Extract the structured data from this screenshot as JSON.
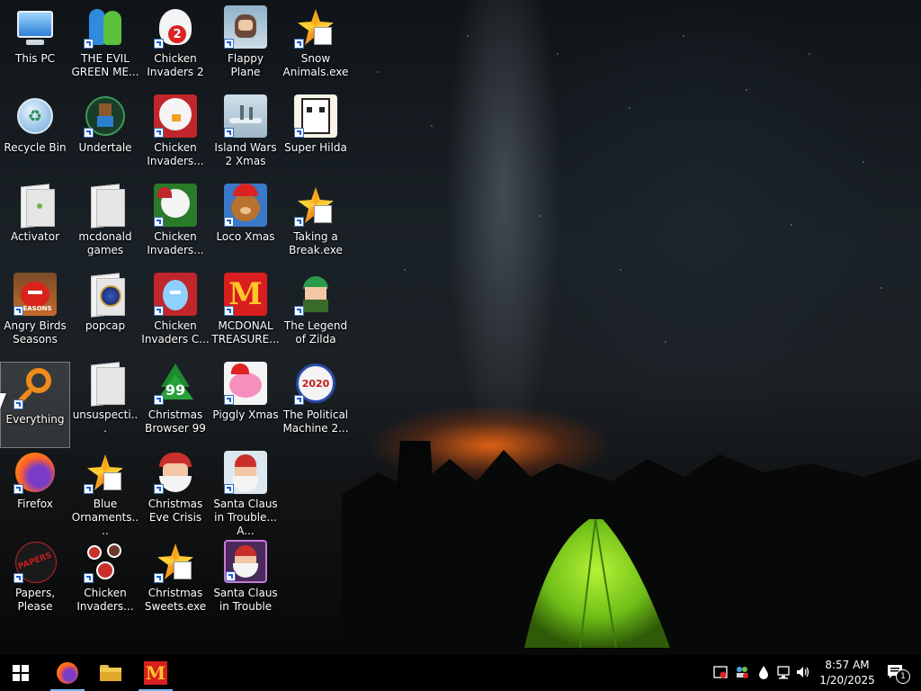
{
  "desktop": {
    "icons": [
      {
        "label": "This PC",
        "kind": "pc-icon"
      },
      {
        "label": "Recycle Bin",
        "kind": "recycle-bin-icon"
      },
      {
        "label": "Activator",
        "kind": "folder-icon"
      },
      {
        "label": "Angry Birds Seasons",
        "kind": "angry-birds-icon"
      },
      {
        "label": "Everything",
        "kind": "search-magnifier-icon"
      },
      {
        "label": "Firefox",
        "kind": "firefox-icon"
      },
      {
        "label": "Papers, Please",
        "kind": "papers-please-icon"
      },
      {
        "label": "THE EVIL GREEN ME...",
        "kind": "msn-buddy-icon"
      },
      {
        "label": "Undertale",
        "kind": "undertale-icon"
      },
      {
        "label": "mcdonald games",
        "kind": "folder-icon"
      },
      {
        "label": "popcap",
        "kind": "popcap-icon"
      },
      {
        "label": "unsuspecti...",
        "kind": "file-icon"
      },
      {
        "label": "Blue Ornaments....",
        "kind": "exe-icon"
      },
      {
        "label": "Chicken Invaders...",
        "kind": "chicken-invaders-icon"
      },
      {
        "label": "Chicken Invaders 2",
        "kind": "chicken-invaders-icon"
      },
      {
        "label": "Chicken Invaders...",
        "kind": "chicken-invaders-icon"
      },
      {
        "label": "Chicken Invaders...",
        "kind": "chicken-invaders-icon"
      },
      {
        "label": "Chicken Invaders C...",
        "kind": "chicken-invaders-icon"
      },
      {
        "label": "Christmas Browser 99",
        "kind": "tree-icon"
      },
      {
        "label": "Christmas Eve Crisis",
        "kind": "santa-icon"
      },
      {
        "label": "Christmas Sweets.exe",
        "kind": "exe-icon"
      },
      {
        "label": "Flappy Plane",
        "kind": "flappy-plane-icon"
      },
      {
        "label": "Island Wars 2 Xmas",
        "kind": "island-wars-icon"
      },
      {
        "label": "Loco Xmas",
        "kind": "bear-icon"
      },
      {
        "label": "MCDONAL TREASURE...",
        "kind": "mcdonalds-icon"
      },
      {
        "label": "Piggly Xmas",
        "kind": "pig-icon"
      },
      {
        "label": "Santa Claus in Trouble... A...",
        "kind": "santa-icon"
      },
      {
        "label": "Santa Claus in Trouble",
        "kind": "santa-icon"
      },
      {
        "label": "Snow Animals.exe",
        "kind": "exe-icon"
      },
      {
        "label": "Super Hilda",
        "kind": "hilda-icon"
      },
      {
        "label": "Taking a Break.exe",
        "kind": "exe-icon"
      },
      {
        "label": "The Legend of Zilda",
        "kind": "zilda-icon"
      },
      {
        "label": "The Political Machine 2...",
        "kind": "political-machine-icon"
      }
    ]
  },
  "taskbar": {
    "pinned": [
      {
        "name": "start-button",
        "icon": "windows-logo-icon"
      },
      {
        "name": "firefox-taskbar-button",
        "icon": "firefox-icon"
      },
      {
        "name": "file-explorer-taskbar-button",
        "icon": "folder-icon"
      },
      {
        "name": "mcdonalds-taskbar-button",
        "icon": "mcdonalds-icon"
      }
    ],
    "tray": {
      "time": "8:57 AM",
      "date": "1/20/2025",
      "notification_count": "1"
    }
  }
}
